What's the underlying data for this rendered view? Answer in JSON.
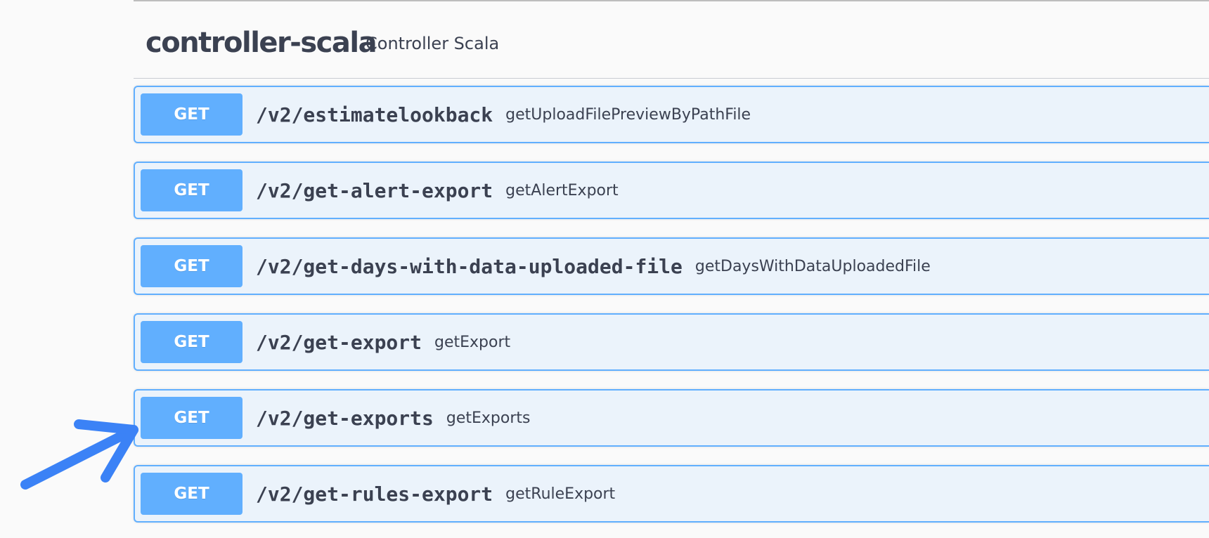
{
  "tag": {
    "name": "controller-scala",
    "description": "Controller Scala"
  },
  "operations": [
    {
      "method": "GET",
      "path": "/v2/estimatelookback",
      "summary": "getUploadFilePreviewByPathFile"
    },
    {
      "method": "GET",
      "path": "/v2/get-alert-export",
      "summary": "getAlertExport"
    },
    {
      "method": "GET",
      "path": "/v2/get-days-with-data-uploaded-file",
      "summary": "getDaysWithDataUploadedFile"
    },
    {
      "method": "GET",
      "path": "/v2/get-export",
      "summary": "getExport"
    },
    {
      "method": "GET",
      "path": "/v2/get-exports",
      "summary": "getExports"
    },
    {
      "method": "GET",
      "path": "/v2/get-rules-export",
      "summary": "getRuleExport"
    }
  ],
  "colors": {
    "get_method": "#61affe",
    "get_block_bg": "#ebf3fb",
    "text": "#3b4151",
    "annotation_arrow": "#3b82f6"
  },
  "annotation": {
    "icon": "arrow-annotation-icon",
    "points_to_operation": "/v2/get-exports"
  }
}
